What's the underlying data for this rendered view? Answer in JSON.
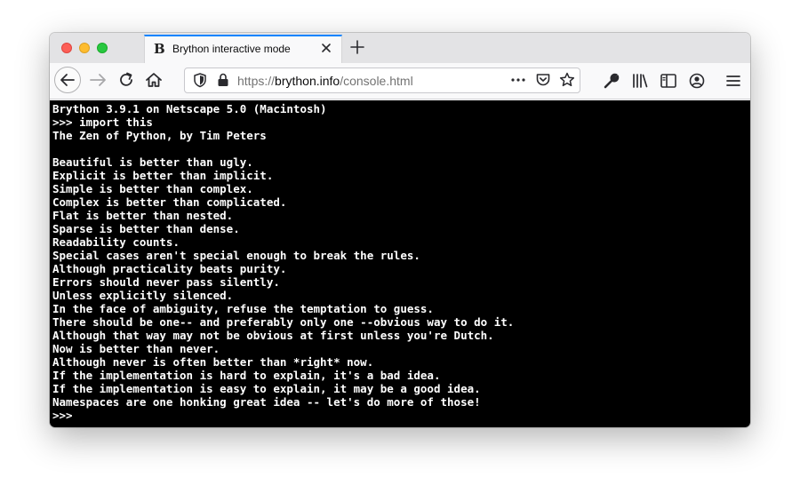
{
  "tab": {
    "favicon": "B",
    "title": "Brython interactive mode"
  },
  "url": {
    "scheme": "https://",
    "host": "brython.info",
    "path": "/console.html"
  },
  "icons": {
    "close": "close-icon",
    "new_tab": "plus-icon",
    "back": "arrow-left-icon",
    "forward": "arrow-right-icon",
    "reload": "reload-icon",
    "home": "home-icon",
    "shield": "shield-icon",
    "lock": "lock-icon",
    "more": "more-icon",
    "pocket": "pocket-icon",
    "bookmark": "star-icon",
    "tools": "wrench-icon",
    "library": "library-icon",
    "sidebar": "sidebar-icon",
    "account": "account-icon",
    "menu": "hamburger-icon"
  },
  "console": {
    "lines": [
      "Brython 3.9.1 on Netscape 5.0 (Macintosh)",
      ">>> import this",
      "The Zen of Python, by Tim Peters",
      "",
      "Beautiful is better than ugly.",
      "Explicit is better than implicit.",
      "Simple is better than complex.",
      "Complex is better than complicated.",
      "Flat is better than nested.",
      "Sparse is better than dense.",
      "Readability counts.",
      "Special cases aren't special enough to break the rules.",
      "Although practicality beats purity.",
      "Errors should never pass silently.",
      "Unless explicitly silenced.",
      "In the face of ambiguity, refuse the temptation to guess.",
      "There should be one-- and preferably only one --obvious way to do it.",
      "Although that way may not be obvious at first unless you're Dutch.",
      "Now is better than never.",
      "Although never is often better than *right* now.",
      "If the implementation is hard to explain, it's a bad idea.",
      "If the implementation is easy to explain, it may be a good idea.",
      "Namespaces are one honking great idea -- let's do more of those!",
      ">>>"
    ]
  }
}
